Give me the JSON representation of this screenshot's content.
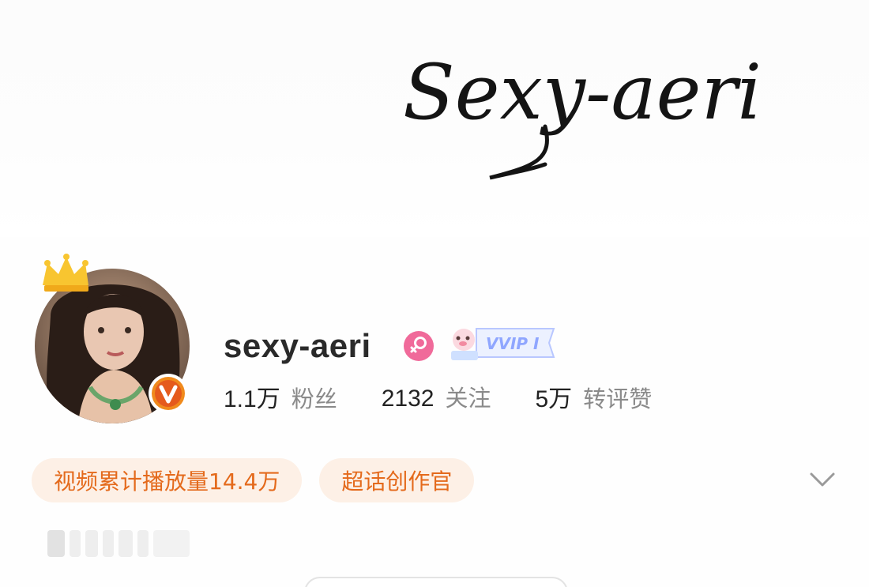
{
  "banner": {
    "signature_text": "Sexy-aeri"
  },
  "profile": {
    "username": "sexy-aeri",
    "vip_text": "VVIP I"
  },
  "stats": [
    {
      "value": "1.1万",
      "label": "粉丝"
    },
    {
      "value": "2132",
      "label": "关注"
    },
    {
      "value": "5万",
      "label": "转评赞"
    }
  ],
  "tags": [
    {
      "label": "视频累计播放量14.4万"
    },
    {
      "label": "超话创作官"
    }
  ],
  "colors": {
    "tag_bg": "#fdf0e6",
    "tag_text": "#e46a1c",
    "gender_pink": "#f06a9a",
    "vip_blue": "#8fa6ff",
    "verified_orange": "#f08a1c"
  },
  "icons": {
    "crown": "crown-icon",
    "verified": "verified-v-icon",
    "gender": "female-icon",
    "expand": "chevron-down-icon"
  }
}
